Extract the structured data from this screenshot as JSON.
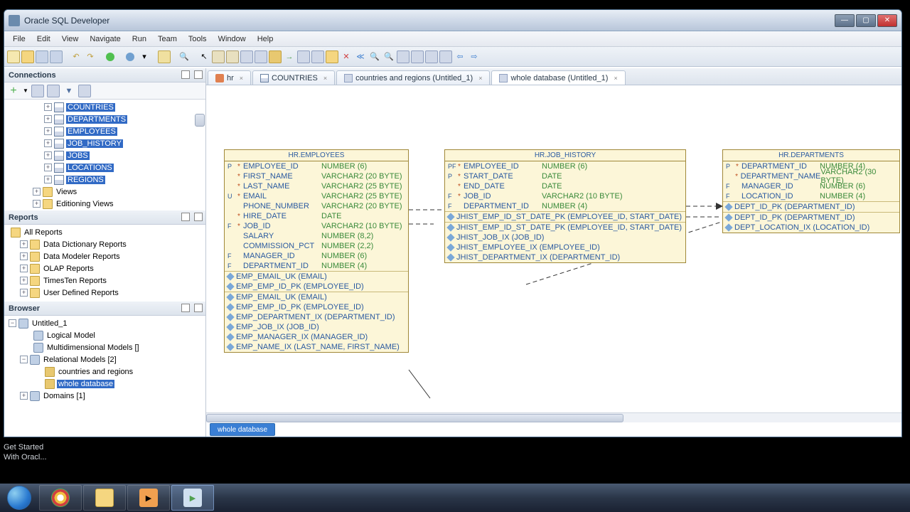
{
  "window": {
    "title": "Oracle SQL Developer"
  },
  "menu": {
    "file": "File",
    "edit": "Edit",
    "view": "View",
    "navigate": "Navigate",
    "run": "Run",
    "team": "Team",
    "tools": "Tools",
    "window": "Window",
    "help": "Help"
  },
  "panels": {
    "connections": "Connections",
    "reports": "Reports",
    "browser": "Browser"
  },
  "conn_tree": {
    "items": [
      {
        "lbl": "COUNTRIES"
      },
      {
        "lbl": "DEPARTMENTS"
      },
      {
        "lbl": "EMPLOYEES"
      },
      {
        "lbl": "JOB_HISTORY"
      },
      {
        "lbl": "JOBS"
      },
      {
        "lbl": "LOCATIONS"
      },
      {
        "lbl": "REGIONS"
      }
    ],
    "views": "Views",
    "editioning": "Editioning Views"
  },
  "reports_tree": {
    "all": "All Reports",
    "dd": "Data Dictionary Reports",
    "dm": "Data Modeler Reports",
    "olap": "OLAP Reports",
    "tt": "TimesTen Reports",
    "ud": "User Defined Reports"
  },
  "browser_tree": {
    "root": "Untitled_1",
    "logical": "Logical Model",
    "multi": "Multidimensional Models []",
    "rel": "Relational Models [2]",
    "cr": "countries and regions",
    "wd": "whole database",
    "dom": "Domains [1]"
  },
  "tabs": {
    "t1": "hr",
    "t2": "COUNTRIES",
    "t3": "countries and regions (Untitled_1)",
    "t4": "whole database (Untitled_1)"
  },
  "entities": {
    "emp": {
      "title": "HR.EMPLOYEES",
      "cols": [
        {
          "k": "P",
          "m": "*",
          "n": "EMPLOYEE_ID",
          "t": "NUMBER (6)"
        },
        {
          "k": "",
          "m": "*",
          "n": "FIRST_NAME",
          "t": "VARCHAR2 (20 BYTE)"
        },
        {
          "k": "",
          "m": "*",
          "n": "LAST_NAME",
          "t": "VARCHAR2 (25 BYTE)"
        },
        {
          "k": "U",
          "m": "*",
          "n": "EMAIL",
          "t": "VARCHAR2 (25 BYTE)"
        },
        {
          "k": "",
          "m": "",
          "n": "PHONE_NUMBER",
          "t": "VARCHAR2 (20 BYTE)"
        },
        {
          "k": "",
          "m": "*",
          "n": "HIRE_DATE",
          "t": "DATE"
        },
        {
          "k": "F",
          "m": "*",
          "n": "JOB_ID",
          "t": "VARCHAR2 (10 BYTE)"
        },
        {
          "k": "",
          "m": "",
          "n": "SALARY",
          "t": "NUMBER (8,2)"
        },
        {
          "k": "",
          "m": "",
          "n": "COMMISSION_PCT",
          "t": "NUMBER (2,2)"
        },
        {
          "k": "F",
          "m": "",
          "n": "MANAGER_ID",
          "t": "NUMBER (6)"
        },
        {
          "k": "F",
          "m": "",
          "n": "DEPARTMENT_ID",
          "t": "NUMBER (4)"
        }
      ],
      "idx1": [
        "EMP_EMAIL_UK (EMAIL)",
        "EMP_EMP_ID_PK (EMPLOYEE_ID)"
      ],
      "idx2": [
        "EMP_EMAIL_UK (EMAIL)",
        "EMP_EMP_ID_PK (EMPLOYEE_ID)",
        "EMP_DEPARTMENT_IX (DEPARTMENT_ID)",
        "EMP_JOB_IX (JOB_ID)",
        "EMP_MANAGER_IX (MANAGER_ID)",
        "EMP_NAME_IX (LAST_NAME, FIRST_NAME)"
      ]
    },
    "jh": {
      "title": "HR.JOB_HISTORY",
      "cols": [
        {
          "k": "PF",
          "m": "*",
          "n": "EMPLOYEE_ID",
          "t": "NUMBER (6)"
        },
        {
          "k": "P",
          "m": "*",
          "n": "START_DATE",
          "t": "DATE"
        },
        {
          "k": "",
          "m": "*",
          "n": "END_DATE",
          "t": "DATE"
        },
        {
          "k": "F",
          "m": "*",
          "n": "JOB_ID",
          "t": "VARCHAR2 (10 BYTE)"
        },
        {
          "k": "F",
          "m": "",
          "n": "DEPARTMENT_ID",
          "t": "NUMBER (4)"
        }
      ],
      "idx1": [
        "JHIST_EMP_ID_ST_DATE_PK (EMPLOYEE_ID, START_DATE)"
      ],
      "idx2": [
        "JHIST_EMP_ID_ST_DATE_PK (EMPLOYEE_ID, START_DATE)",
        "JHIST_JOB_IX (JOB_ID)",
        "JHIST_EMPLOYEE_IX (EMPLOYEE_ID)",
        "JHIST_DEPARTMENT_IX (DEPARTMENT_ID)"
      ]
    },
    "dep": {
      "title": "HR.DEPARTMENTS",
      "cols": [
        {
          "k": "P",
          "m": "*",
          "n": "DEPARTMENT_ID",
          "t": "NUMBER (4)"
        },
        {
          "k": "",
          "m": "*",
          "n": "DEPARTMENT_NAME",
          "t": "VARCHAR2 (30 BYTE)"
        },
        {
          "k": "F",
          "m": "",
          "n": "MANAGER_ID",
          "t": "NUMBER (6)"
        },
        {
          "k": "F",
          "m": "",
          "n": "LOCATION_ID",
          "t": "NUMBER (4)"
        }
      ],
      "idx1": [
        "DEPT_ID_PK (DEPARTMENT_ID)"
      ],
      "idx2": [
        "DEPT_ID_PK (DEPARTMENT_ID)",
        "DEPT_LOCATION_IX (LOCATION_ID)"
      ]
    }
  },
  "bottom_tab": "whole database",
  "status": {
    "l1": "Get Started",
    "l2": "With Oracl..."
  }
}
